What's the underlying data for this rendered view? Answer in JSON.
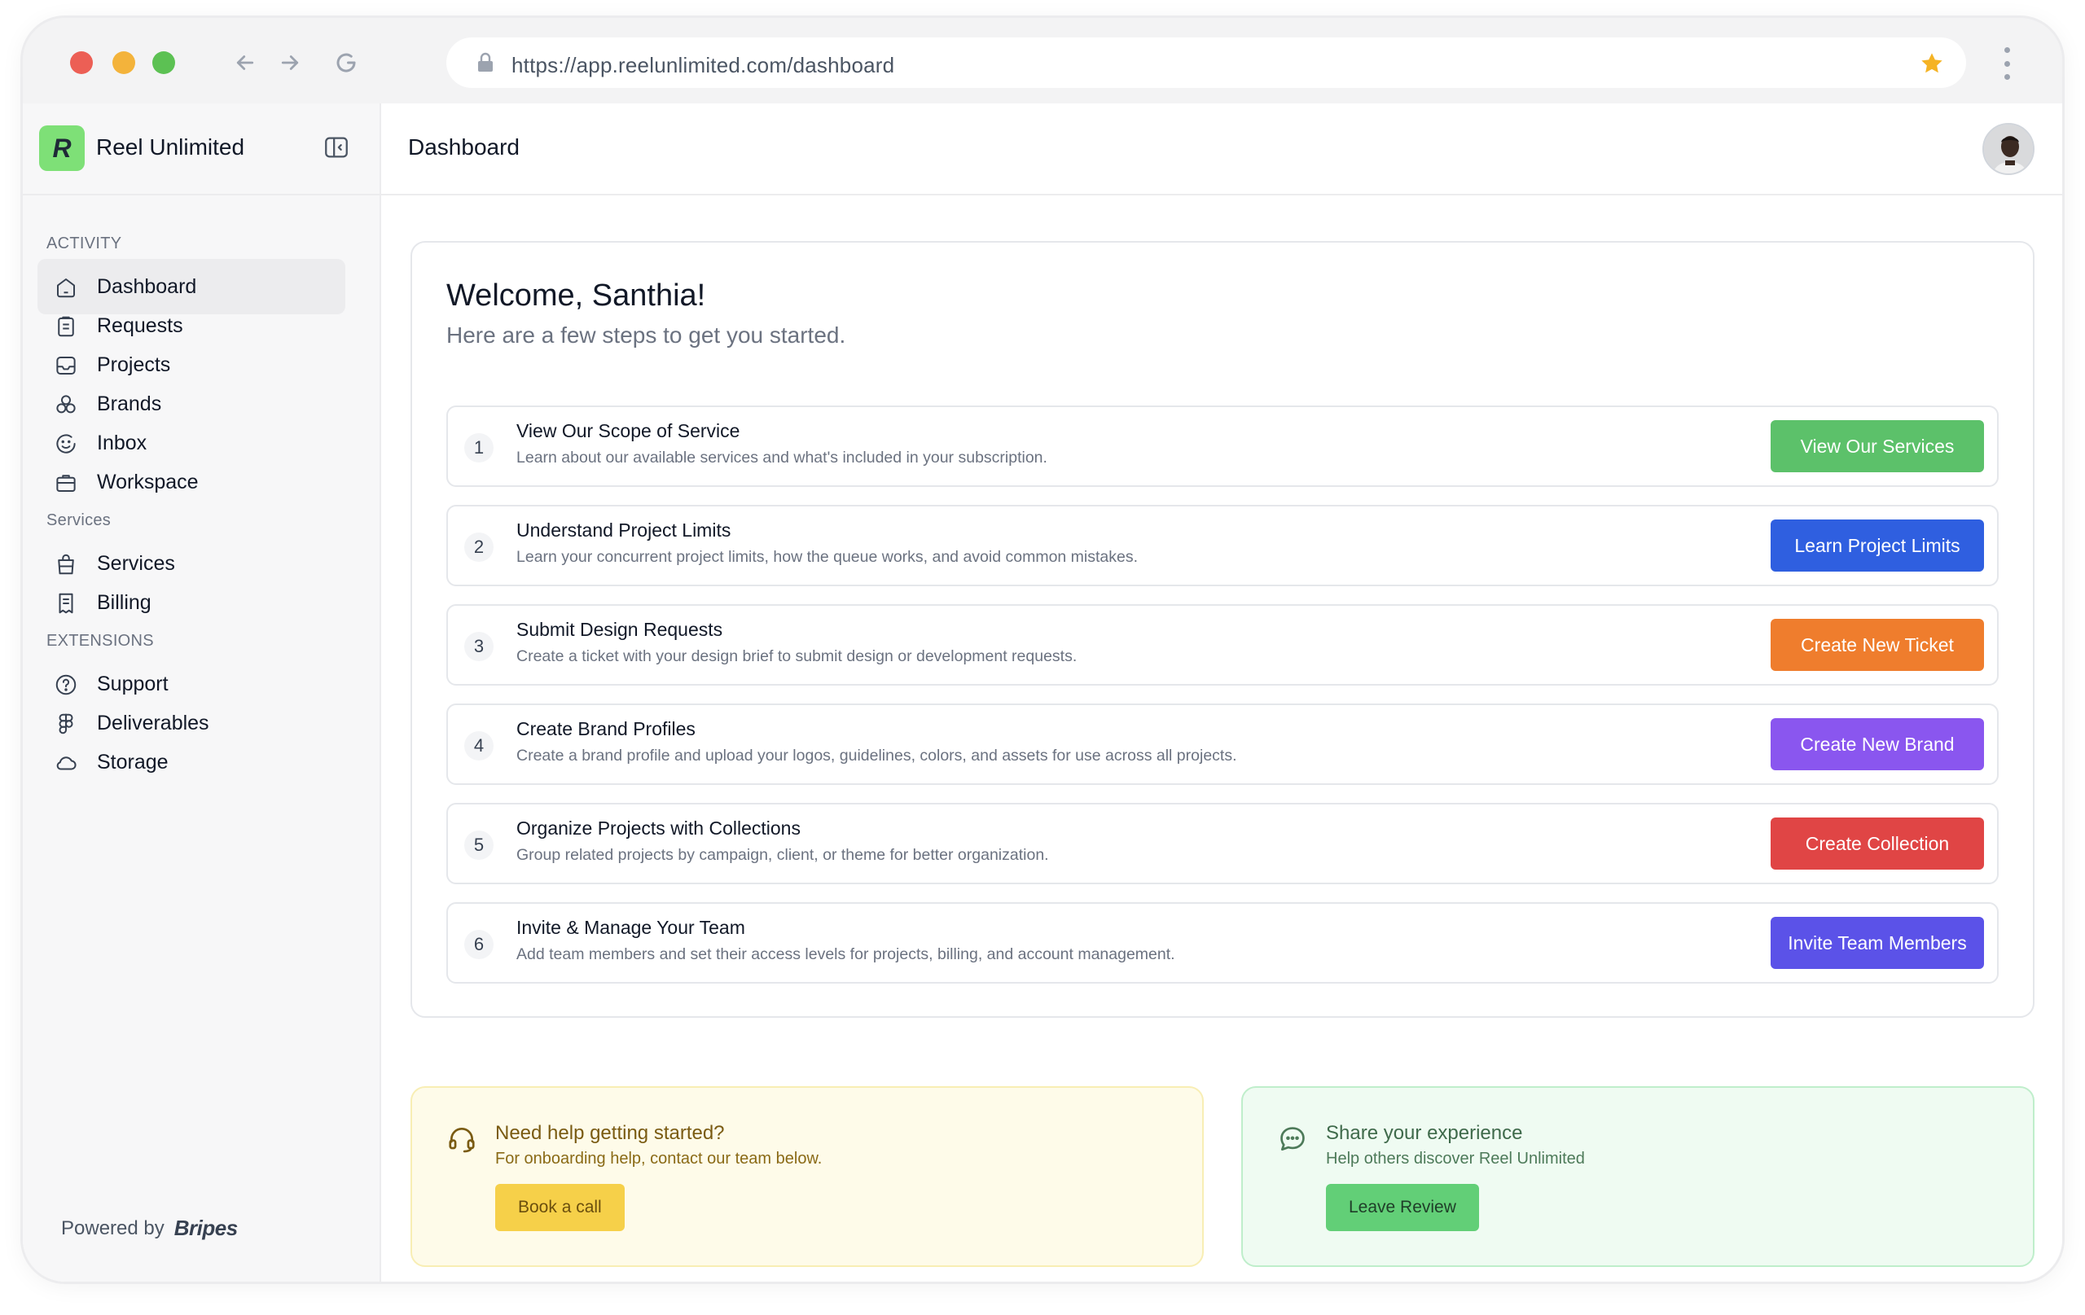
{
  "browser": {
    "url": "https://app.reelunlimited.com/dashboard"
  },
  "brand": {
    "logo_letter": "R",
    "name": "Reel Unlimited",
    "logo_color": "#7ee077"
  },
  "sidebar": {
    "sections": [
      {
        "label": "ACTIVITY",
        "items": [
          {
            "label": "Dashboard",
            "icon": "home-icon",
            "active": true
          },
          {
            "label": "Requests",
            "icon": "clipboard-icon"
          },
          {
            "label": "Projects",
            "icon": "inbox-tray-icon"
          },
          {
            "label": "Brands",
            "icon": "shapes-icon"
          },
          {
            "label": "Inbox",
            "icon": "chat-smile-icon"
          },
          {
            "label": "Workspace",
            "icon": "briefcase-icon"
          }
        ]
      },
      {
        "label": "Services",
        "items": [
          {
            "label": "Services",
            "icon": "shopping-bag-icon"
          },
          {
            "label": "Billing",
            "icon": "receipt-icon"
          }
        ]
      },
      {
        "label": "EXTENSIONS",
        "items": [
          {
            "label": "Support",
            "icon": "help-circle-icon"
          },
          {
            "label": "Deliverables",
            "icon": "figma-icon"
          },
          {
            "label": "Storage",
            "icon": "cloud-icon"
          }
        ]
      }
    ],
    "powered_by": "Powered by",
    "powered_brand": "Bripes"
  },
  "header": {
    "title": "Dashboard"
  },
  "welcome": {
    "title": "Welcome, Santhia!",
    "subtitle": "Here are a few steps to get you started."
  },
  "steps": [
    {
      "num": "1",
      "title": "View Our Scope of Service",
      "desc": "Learn about our available services and what's included in your subscription.",
      "button": "View Our Services",
      "color": "#5cc16a"
    },
    {
      "num": "2",
      "title": "Understand Project Limits",
      "desc": "Learn your concurrent project limits, how the queue works, and avoid common mistakes.",
      "button": "Learn Project Limits",
      "color": "#2f5fe0"
    },
    {
      "num": "3",
      "title": "Submit Design Requests",
      "desc": "Create a ticket with your design brief to submit design or development requests.",
      "button": "Create New Ticket",
      "color": "#ef7d2d"
    },
    {
      "num": "4",
      "title": "Create Brand Profiles",
      "desc": "Create a brand profile and upload your logos, guidelines, colors, and assets for use across all projects.",
      "button": "Create New Brand",
      "color": "#8a56ef"
    },
    {
      "num": "5",
      "title": "Organize Projects with Collections",
      "desc": "Group related projects by campaign, client, or theme for better organization.",
      "button": "Create Collection",
      "color": "#e04545"
    },
    {
      "num": "6",
      "title": "Invite & Manage Your Team",
      "desc": "Add team members and set their access levels for projects, billing, and account management.",
      "button": "Invite Team Members",
      "color": "#5b52e8"
    }
  ],
  "help": {
    "title": "Need help getting started?",
    "subtitle": "For onboarding help, contact our team below.",
    "button": "Book a call"
  },
  "review": {
    "title": "Share your experience",
    "subtitle": "Help others discover Reel Unlimited",
    "button": "Leave Review"
  }
}
